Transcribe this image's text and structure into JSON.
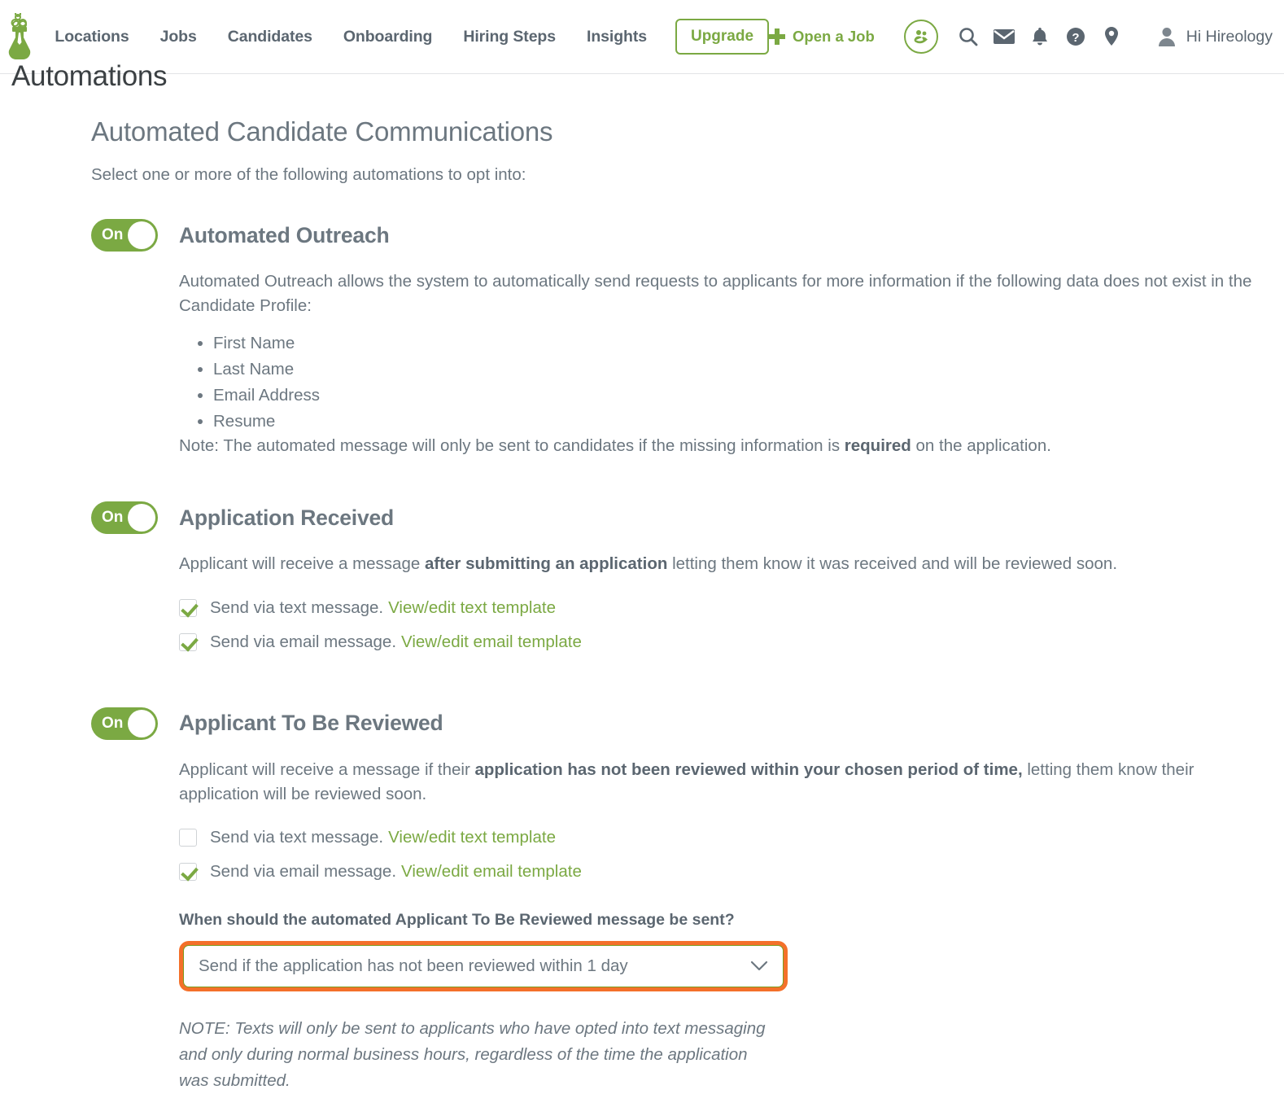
{
  "nav": {
    "logo_name": "hireology-flask-logo",
    "links": [
      {
        "label": "Locations"
      },
      {
        "label": "Jobs"
      },
      {
        "label": "Candidates"
      },
      {
        "label": "Onboarding"
      },
      {
        "label": "Hiring Steps"
      },
      {
        "label": "Insights"
      }
    ],
    "upgrade_label": "Upgrade",
    "open_job_label": "Open a Job",
    "icons": [
      "referrals-icon",
      "search-icon",
      "messages-envelope-icon",
      "notifications-bell-icon",
      "help-circle-icon",
      "location-pin-icon"
    ],
    "user_label": "Hi Hireology",
    "accent_green": "#7ba943",
    "text_gray": "#5b6670"
  },
  "page": {
    "title": "Automations"
  },
  "main": {
    "heading": "Automated Candidate Communications",
    "subheading": "Select one or more of the following automations to opt into:",
    "highlight_color": "#f4702a"
  },
  "automations": [
    {
      "toggle_state": "On",
      "name": "Automated Outreach",
      "description": "Automated Outreach allows the system to automatically send requests to applicants for more information if the following data does not exist in the Candidate Profile:",
      "fields": [
        "First Name",
        "Last Name",
        "Email Address",
        "Resume"
      ],
      "note_prefix": "Note: The automated message will only be sent to candidates if the missing information is ",
      "note_bold": "required",
      "note_suffix": " on the application."
    },
    {
      "toggle_state": "On",
      "name": "Application Received",
      "desc_prefix": "Applicant will receive a message ",
      "desc_bold": "after submitting an application",
      "desc_suffix": " letting them know it was received and will be reviewed soon.",
      "channels": [
        {
          "checked": true,
          "label": "Send via text message.",
          "link": "View/edit text template"
        },
        {
          "checked": true,
          "label": "Send via email message.",
          "link": "View/edit email template"
        }
      ]
    },
    {
      "toggle_state": "On",
      "name": "Applicant To Be Reviewed",
      "desc_prefix": "Applicant will receive a message if their ",
      "desc_bold": "application has not been reviewed within your chosen period of time,",
      "desc_suffix": " letting them know their application will be reviewed soon.",
      "channels": [
        {
          "checked": false,
          "label": "Send via text message.",
          "link": "View/edit text template"
        },
        {
          "checked": true,
          "label": "Send via email message.",
          "link": "View/edit email template"
        }
      ],
      "question_label": "When should the automated Applicant To Be Reviewed message be sent?",
      "select_value": "Send if the application has not been reviewed within 1 day",
      "trailing_note": "NOTE: Texts will only be sent to applicants who have opted into text messaging and only during normal business hours, regardless of the time the application was submitted."
    }
  ]
}
